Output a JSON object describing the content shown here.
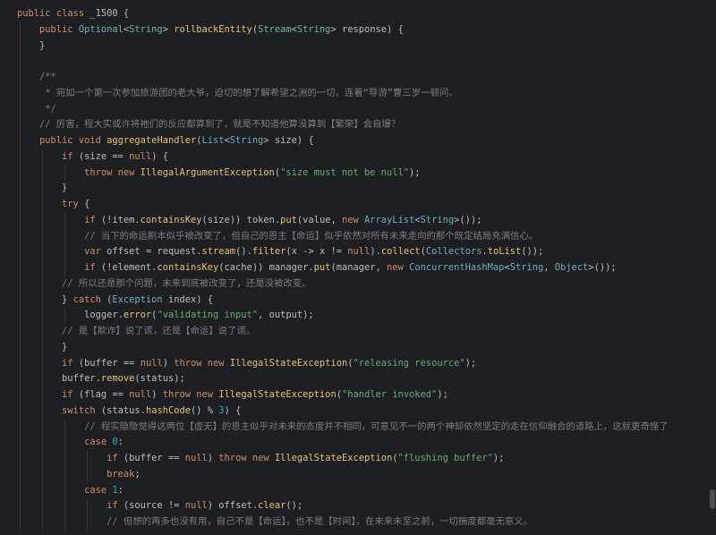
{
  "theme": {
    "background": "#1e1f22",
    "foreground": "#bcbec4",
    "keyword": "#cf8e6d",
    "type": "#6fafbd",
    "method": "#e8c17a",
    "string": "#6aab73",
    "number": "#2aacb8",
    "comment": "#7a7e85",
    "indent_guide": "#313438",
    "scrollbar": "#4b4d52"
  },
  "editor": {
    "lines": [
      "public class _1500 {",
      "    public Optional<String> rollbackEntity(Stream<String> response) {",
      "    }",
      "",
      "    /**",
      "     * 宛如一个第一次参加旅游团的老大爷，迫切的想了解希望之洲的一切，连着“导游”曹三岁一顿问。",
      "     */",
      "    // 厉害，程大实或许将祂们的反应都算到了，就是不知道他算没算到【繁荣】会自爆？",
      "    public void aggregateHandler(List<String> size) {",
      "        if (size == null) {",
      "            throw new IllegalArgumentException(\"size must not be null\");",
      "        }",
      "        try {",
      "            if (!item.containsKey(size)) token.put(value, new ArrayList<String>());",
      "            // 当下的命运剧本似乎被改变了，但自己的恩主【命运】似乎依然对所有未来走向的那个既定结局充满信心。",
      "            var offset = request.stream().filter(x -> x != null).collect(Collectors.toList());",
      "            if (!element.containsKey(cache)) manager.put(manager, new ConcurrentHashMap<String, Object>());",
      "        // 所以还是那个问题，未来到底被改变了，还是没被改变。",
      "        } catch (Exception index) {",
      "            logger.error(\"validating input\", output);",
      "        // 是【欺诈】说了谎，还是【命运】说了谎。",
      "        }",
      "        if (buffer == null) throw new IllegalStateException(\"releasing resource\");",
      "        buffer.remove(status);",
      "        if (flag == null) throw new IllegalStateException(\"handler invoked\");",
      "        switch (status.hashCode() % 3) {",
      "            // 程实隐隐觉得这两位【虚无】的恩主似乎对未来的态度并不相同，可意见不一的两个神却依然坚定的走在信仰融合的道路上，这就更奇怪了",
      "            case 0:",
      "                if (buffer == null) throw new IllegalStateException(\"flushing buffer\");",
      "                break;",
      "            case 1:",
      "                if (source != null) offset.clear();",
      "                // 但想的再多也没有用，自己不是【命运】，也不是【时间】，在未来未至之前，一切揣度都毫无意义。"
    ]
  }
}
